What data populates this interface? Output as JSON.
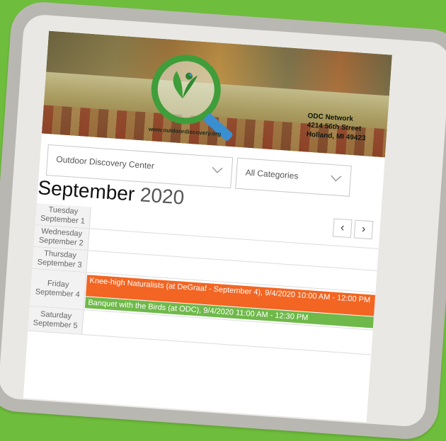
{
  "banner": {
    "website": "www.outdoordiscovery.org",
    "address_lines": [
      "ODC Network",
      "4214 56th Street",
      "Holland, MI 49423"
    ]
  },
  "filters": {
    "location": "Outdoor Discovery Center",
    "category": "All Categories"
  },
  "calendar": {
    "month": "September",
    "year": "2020",
    "prev_label": "‹",
    "next_label": "›",
    "days": [
      {
        "weekday": "Tuesday",
        "date": "September 1"
      },
      {
        "weekday": "Wednesday",
        "date": "September 2"
      },
      {
        "weekday": "Thursday",
        "date": "September 3"
      },
      {
        "weekday": "Friday",
        "date": "September 4"
      },
      {
        "weekday": "Saturday",
        "date": "September 5"
      }
    ],
    "events": [
      {
        "text": "Knee-high Naturalists (at DeGraaf - September 4), 9/4/2020 10:00 AM - 12:00 PM",
        "color": "#f26522"
      },
      {
        "text": "Banquet with the Birds (at ODC), 9/4/2020 11:00 AM - 12:30 PM",
        "color": "#6fb94a"
      }
    ]
  },
  "colors": {
    "background": "#6fbd3c",
    "logo_green": "#3f9e3a",
    "logo_blue": "#3a8fd0"
  }
}
